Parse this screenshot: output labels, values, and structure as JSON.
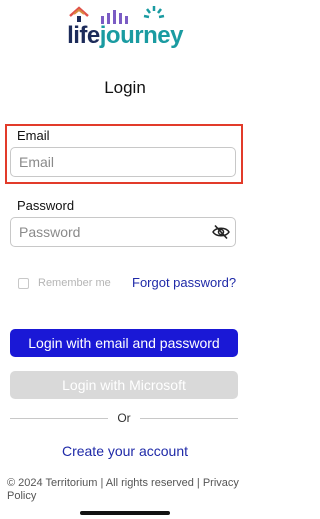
{
  "brand": {
    "part1": "life",
    "part2": "journey"
  },
  "page": {
    "title": "Login"
  },
  "email": {
    "label": "Email",
    "placeholder": "Email",
    "value": ""
  },
  "password": {
    "label": "Password",
    "placeholder": "Password",
    "value": ""
  },
  "remember": {
    "label": "Remember me",
    "checked": false
  },
  "links": {
    "forgot": "Forgot password?",
    "create": "Create your account"
  },
  "buttons": {
    "primary": "Login with email and password",
    "microsoft": "Login with Microsoft"
  },
  "divider": {
    "text": "Or"
  },
  "footer": {
    "copyright": "© 2024 Territorium | All rights reserved |",
    "privacy": "Privacy Policy"
  },
  "colors": {
    "primary": "#1a18d6",
    "link": "#1f2aa8",
    "highlight": "#e23b2a",
    "brand_navy": "#1c2b5a",
    "brand_teal": "#1a9ba1"
  },
  "icons": {
    "logo": "lifejourney-logo",
    "eye": "eye-slash-icon"
  }
}
